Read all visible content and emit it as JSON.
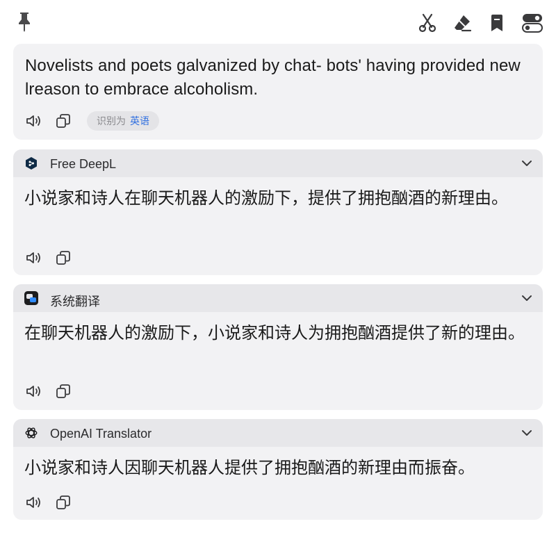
{
  "toolbar": {
    "icons": [
      "pin-icon",
      "scissors-icon",
      "eraser-icon",
      "bookmark-icon",
      "toggle-icon"
    ]
  },
  "source": {
    "text": "Novelists and poets galvanized by chat- bots' having provided new lreason to embrace alcoholism.",
    "detect_prefix": "识别为",
    "detect_lang": "英语"
  },
  "services": [
    {
      "name": "Free DeepL",
      "result": "小说家和诗人在聊天机器人的激励下，提供了拥抱酗酒的新理由。"
    },
    {
      "name": "系统翻译",
      "result": "在聊天机器人的激励下，小说家和诗人为拥抱酗酒提供了新的理由。"
    },
    {
      "name": "OpenAI Translator",
      "result": "小说家和诗人因聊天机器人提供了拥抱酗酒的新理由而振奋。"
    }
  ],
  "colors": {
    "card_bg": "#f2f2f4",
    "header_bg": "#e7e7ea",
    "accent": "#2f6fe0",
    "icon": "#3a3a3c"
  }
}
